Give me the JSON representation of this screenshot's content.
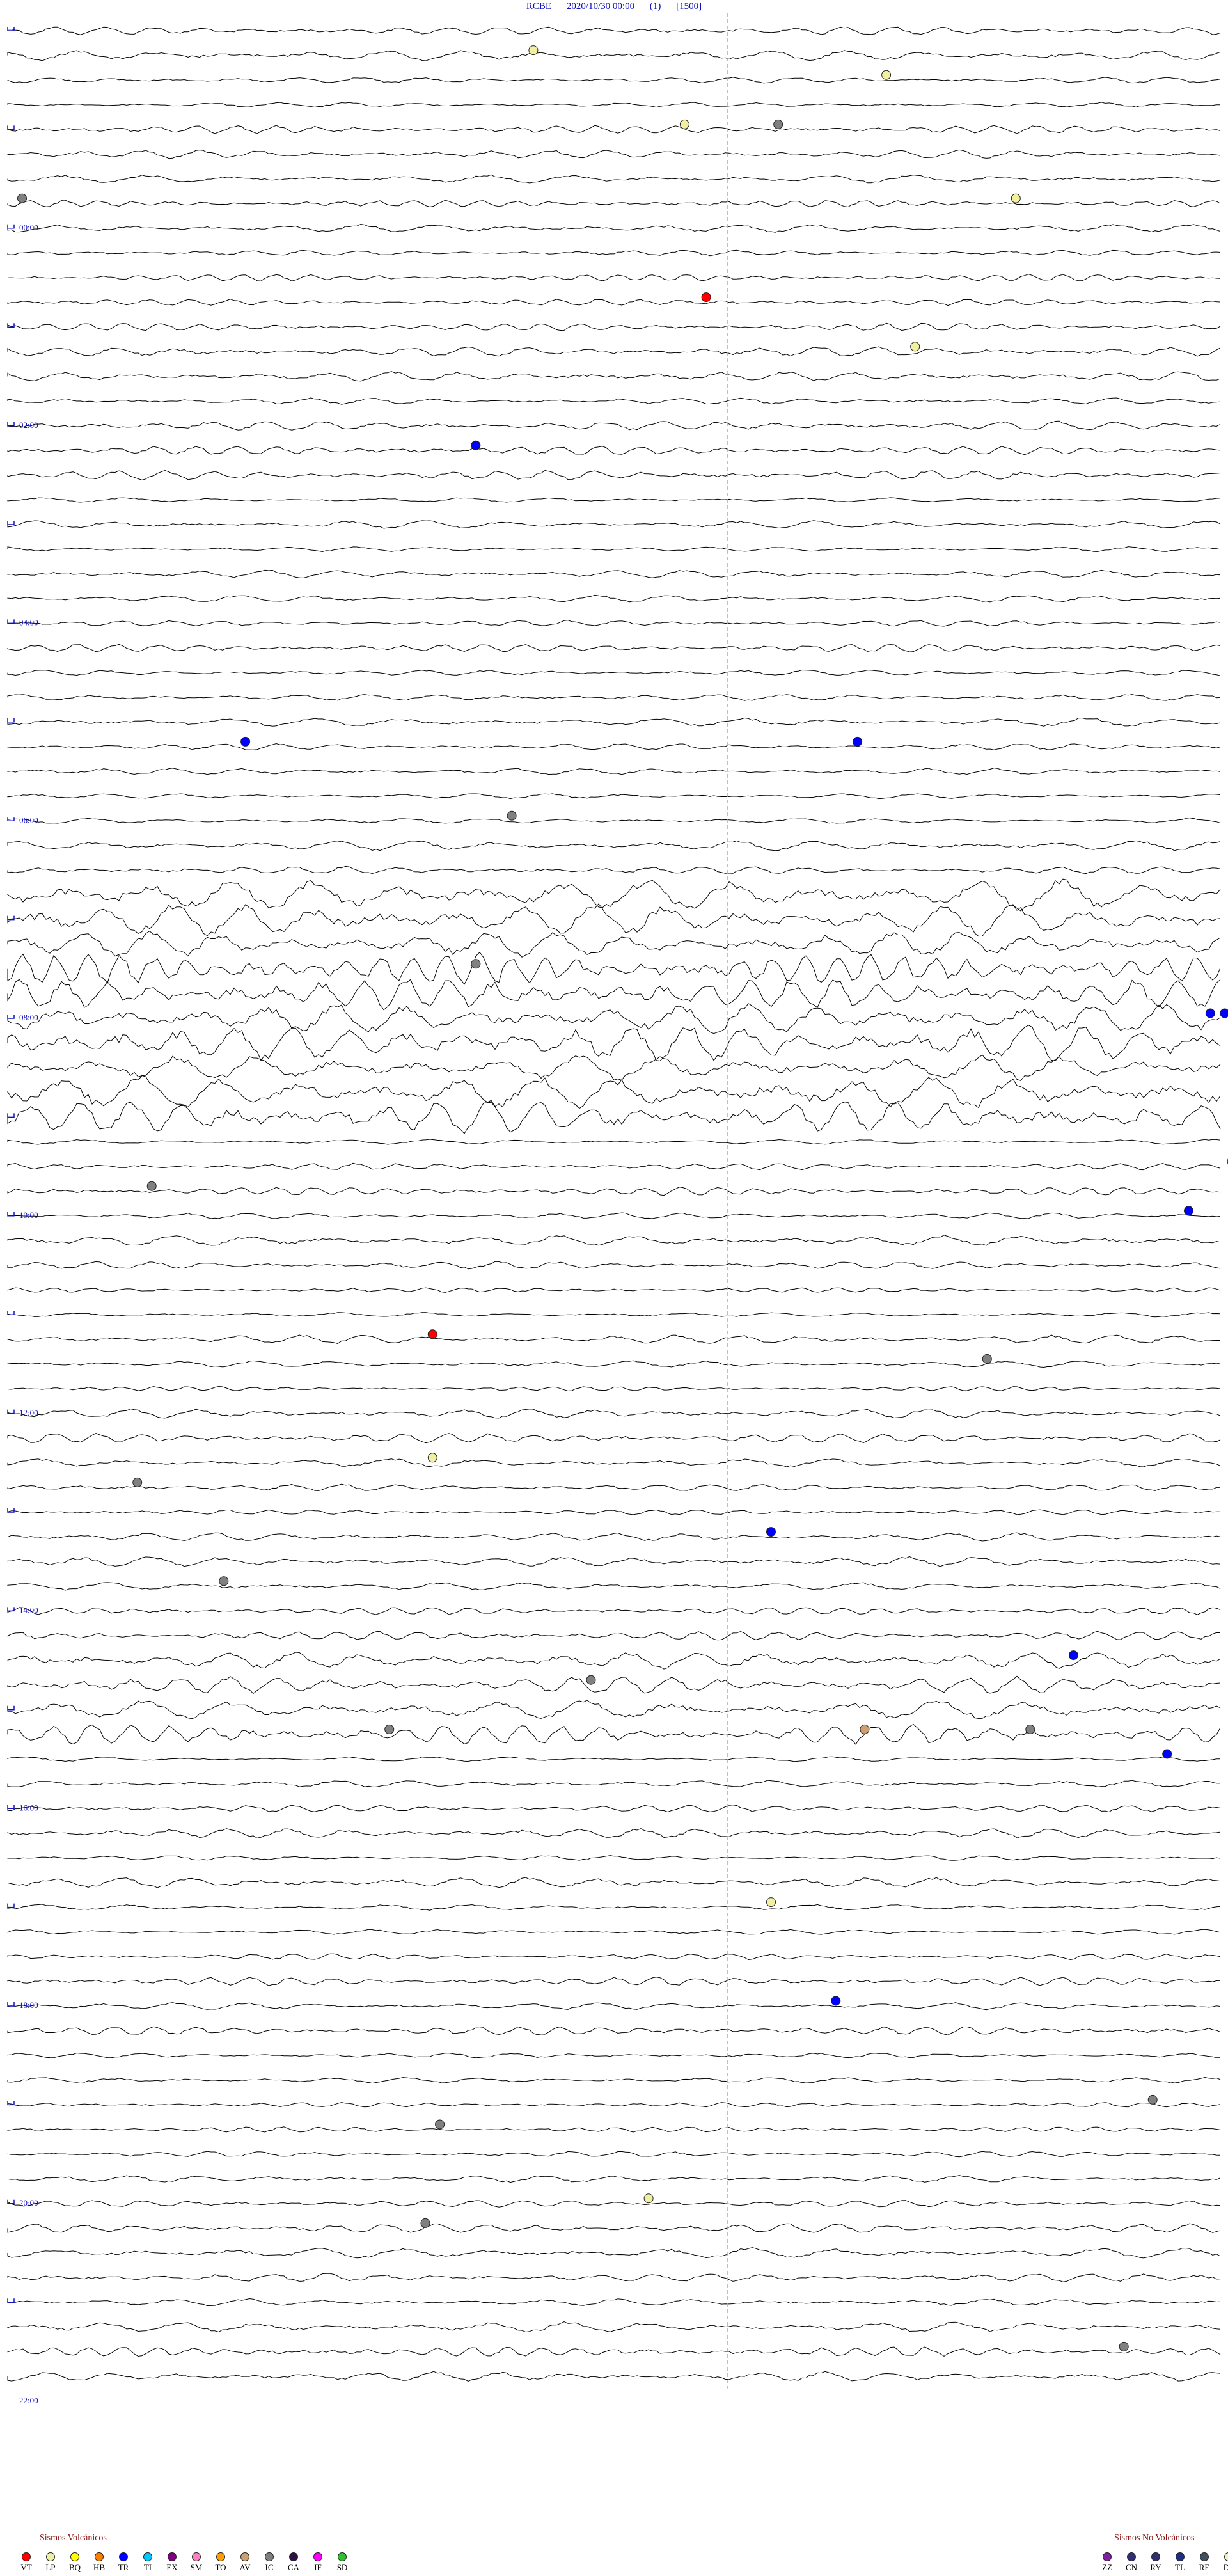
{
  "header": {
    "station": "RCBE",
    "datetime": "2020/10/30 00:00",
    "channel": "(1)",
    "scale": "[1500]"
  },
  "chart_data": {
    "type": "helicorder",
    "title": "RCBE 2020/10/30 00:00 (1) [1500]",
    "rows": 96,
    "minutes_per_row": 15,
    "hour_labels": [
      "00:00",
      "02:00",
      "04:00",
      "06:00",
      "08:00",
      "10:00",
      "12:00",
      "14:00",
      "16:00",
      "18:00",
      "20:00",
      "22:00"
    ],
    "minute_marks": [
      10,
      20,
      30,
      40
    ],
    "events": [
      {
        "row": 1,
        "minute": 7.3,
        "type": "LP"
      },
      {
        "row": 1,
        "minute": 28.5,
        "type": "LP"
      },
      {
        "row": 2,
        "minute": 12.2,
        "type": "LP"
      },
      {
        "row": 2,
        "minute": 41.8,
        "type": "LP"
      },
      {
        "row": 4,
        "minute": 9.4,
        "type": "LP"
      },
      {
        "row": 4,
        "minute": 10.7,
        "type": "IC"
      },
      {
        "row": 4,
        "minute": 38.6,
        "type": "IC"
      },
      {
        "row": 7,
        "minute": 0.2,
        "type": "IC"
      },
      {
        "row": 7,
        "minute": 14.0,
        "type": "LP"
      },
      {
        "row": 8,
        "minute": 32.4,
        "type": "LP"
      },
      {
        "row": 10,
        "minute": 20.8,
        "type": "LP"
      },
      {
        "row": 10,
        "minute": 35.1,
        "type": "LP"
      },
      {
        "row": 11,
        "minute": 9.7,
        "type": "VT"
      },
      {
        "row": 11,
        "minute": 44.0,
        "type": "LP"
      },
      {
        "row": 12,
        "minute": 39.4,
        "type": "IC"
      },
      {
        "row": 13,
        "minute": 12.6,
        "type": "LP"
      },
      {
        "row": 16,
        "minute": 25.4,
        "type": "TR"
      },
      {
        "row": 17,
        "minute": 6.5,
        "type": "TR"
      },
      {
        "row": 18,
        "minute": 24.2,
        "type": "IC"
      },
      {
        "row": 21,
        "minute": 40.6,
        "type": "IC"
      },
      {
        "row": 22,
        "minute": 24.5,
        "type": "LP"
      },
      {
        "row": 24,
        "minute": 32.9,
        "type": "LP"
      },
      {
        "row": 26,
        "minute": 37.6,
        "type": "LP"
      },
      {
        "row": 27,
        "minute": 18.1,
        "type": "IC"
      },
      {
        "row": 29,
        "minute": 3.3,
        "type": "TR"
      },
      {
        "row": 29,
        "minute": 11.8,
        "type": "TR"
      },
      {
        "row": 29,
        "minute": 33.6,
        "type": "EX"
      },
      {
        "row": 32,
        "minute": 7.0,
        "type": "IC"
      },
      {
        "row": 32,
        "minute": 37.8,
        "type": "IC"
      },
      {
        "row": 37,
        "minute": 44.8,
        "type": "TR"
      },
      {
        "row": 38,
        "minute": 6.5,
        "type": "IC"
      },
      {
        "row": 38,
        "minute": 40.4,
        "type": "LP"
      },
      {
        "row": 40,
        "minute": 16.7,
        "type": "TR"
      },
      {
        "row": 40,
        "minute": 16.9,
        "type": "TR"
      },
      {
        "row": 41,
        "minute": 17.6,
        "type": "IC"
      },
      {
        "row": 41,
        "minute": 30.8,
        "type": "AV"
      },
      {
        "row": 42,
        "minute": 19.3,
        "type": "EX"
      },
      {
        "row": 42,
        "minute": 22.3,
        "type": "IC"
      },
      {
        "row": 42,
        "minute": 33.1,
        "type": "IC"
      },
      {
        "row": 43,
        "minute": 21.9,
        "type": "VT"
      },
      {
        "row": 43,
        "minute": 32.8,
        "type": "VT"
      },
      {
        "row": 45,
        "minute": 17.8,
        "type": "IC"
      },
      {
        "row": 46,
        "minute": 17.0,
        "type": "IC"
      },
      {
        "row": 47,
        "minute": 2.0,
        "type": "IC"
      },
      {
        "row": 48,
        "minute": 16.4,
        "type": "TR"
      },
      {
        "row": 53,
        "minute": 5.9,
        "type": "VT"
      },
      {
        "row": 54,
        "minute": 13.6,
        "type": "IC"
      },
      {
        "row": 55,
        "minute": 39.4,
        "type": "LP"
      },
      {
        "row": 58,
        "minute": 5.9,
        "type": "LP"
      },
      {
        "row": 59,
        "minute": 1.8,
        "type": "IC"
      },
      {
        "row": 60,
        "minute": 44.5,
        "type": "TR"
      },
      {
        "row": 61,
        "minute": 10.6,
        "type": "TR"
      },
      {
        "row": 61,
        "minute": 18.1,
        "type": "LP"
      },
      {
        "row": 61,
        "minute": 22.4,
        "type": "IC"
      },
      {
        "row": 63,
        "minute": 3.0,
        "type": "IC"
      },
      {
        "row": 63,
        "minute": 35.5,
        "type": "TR"
      },
      {
        "row": 64,
        "minute": 42.4,
        "type": "IC"
      },
      {
        "row": 66,
        "minute": 14.8,
        "type": "TR"
      },
      {
        "row": 67,
        "minute": 8.1,
        "type": "IC"
      },
      {
        "row": 68,
        "minute": 25.6,
        "type": "IC"
      },
      {
        "row": 69,
        "minute": 5.3,
        "type": "IC"
      },
      {
        "row": 69,
        "minute": 14.2,
        "type": "IC"
      },
      {
        "row": 69,
        "minute": 11.9,
        "type": "AV"
      },
      {
        "row": 70,
        "minute": 16.1,
        "type": "TR"
      },
      {
        "row": 70,
        "minute": 35.4,
        "type": "AV"
      },
      {
        "row": 73,
        "minute": 20.3,
        "type": "IC"
      },
      {
        "row": 73,
        "minute": 34.8,
        "type": "LP"
      },
      {
        "row": 75,
        "minute": 33.4,
        "type": "LP"
      },
      {
        "row": 76,
        "minute": 10.6,
        "type": "LP"
      },
      {
        "row": 76,
        "minute": 34.2,
        "type": "LP"
      },
      {
        "row": 77,
        "minute": 31.4,
        "type": "TR"
      },
      {
        "row": 80,
        "minute": 11.5,
        "type": "TR"
      },
      {
        "row": 80,
        "minute": 23.1,
        "type": "TR"
      },
      {
        "row": 80,
        "minute": 28.9,
        "type": "IC"
      },
      {
        "row": 81,
        "minute": 17.3,
        "type": "IC"
      },
      {
        "row": 84,
        "minute": 15.9,
        "type": "IC"
      },
      {
        "row": 85,
        "minute": 6.0,
        "type": "IC"
      },
      {
        "row": 85,
        "minute": 31.8,
        "type": "IC"
      },
      {
        "row": 86,
        "minute": 35.8,
        "type": "LP"
      },
      {
        "row": 88,
        "minute": 8.9,
        "type": "LP"
      },
      {
        "row": 89,
        "minute": 5.8,
        "type": "IC"
      },
      {
        "row": 94,
        "minute": 15.5,
        "type": "IC"
      },
      {
        "row": 94,
        "minute": 43.6,
        "type": "IC"
      }
    ]
  },
  "legend_volcanic": {
    "title": "Sismos Volcánicos",
    "items": [
      {
        "code": "VT",
        "color": "#ff0000"
      },
      {
        "code": "LP",
        "color": "#f0f0a0"
      },
      {
        "code": "BQ",
        "color": "#ffff00"
      },
      {
        "code": "HB",
        "color": "#ff8000"
      },
      {
        "code": "TR",
        "color": "#0000ff"
      },
      {
        "code": "TI",
        "color": "#00c8ff"
      },
      {
        "code": "EX",
        "color": "#800080"
      },
      {
        "code": "SM",
        "color": "#ff80c0"
      },
      {
        "code": "TO",
        "color": "#ffa000"
      },
      {
        "code": "AV",
        "color": "#cca070"
      },
      {
        "code": "IC",
        "color": "#808080"
      },
      {
        "code": "CA",
        "color": "#301040"
      },
      {
        "code": "IF",
        "color": "#ff00ff"
      },
      {
        "code": "SD",
        "color": "#30c030"
      }
    ]
  },
  "legend_nonvolcanic": {
    "title": "Sismos No Volcánicos",
    "items": [
      {
        "code": "ZZ",
        "color": "#8020a0"
      },
      {
        "code": "CN",
        "color": "#303070"
      },
      {
        "code": "RY",
        "color": "#303070"
      },
      {
        "code": "TL",
        "color": "#203080"
      },
      {
        "code": "RE",
        "color": "#405060"
      },
      {
        "code": "DS",
        "color": "#f0f0c0"
      }
    ]
  }
}
